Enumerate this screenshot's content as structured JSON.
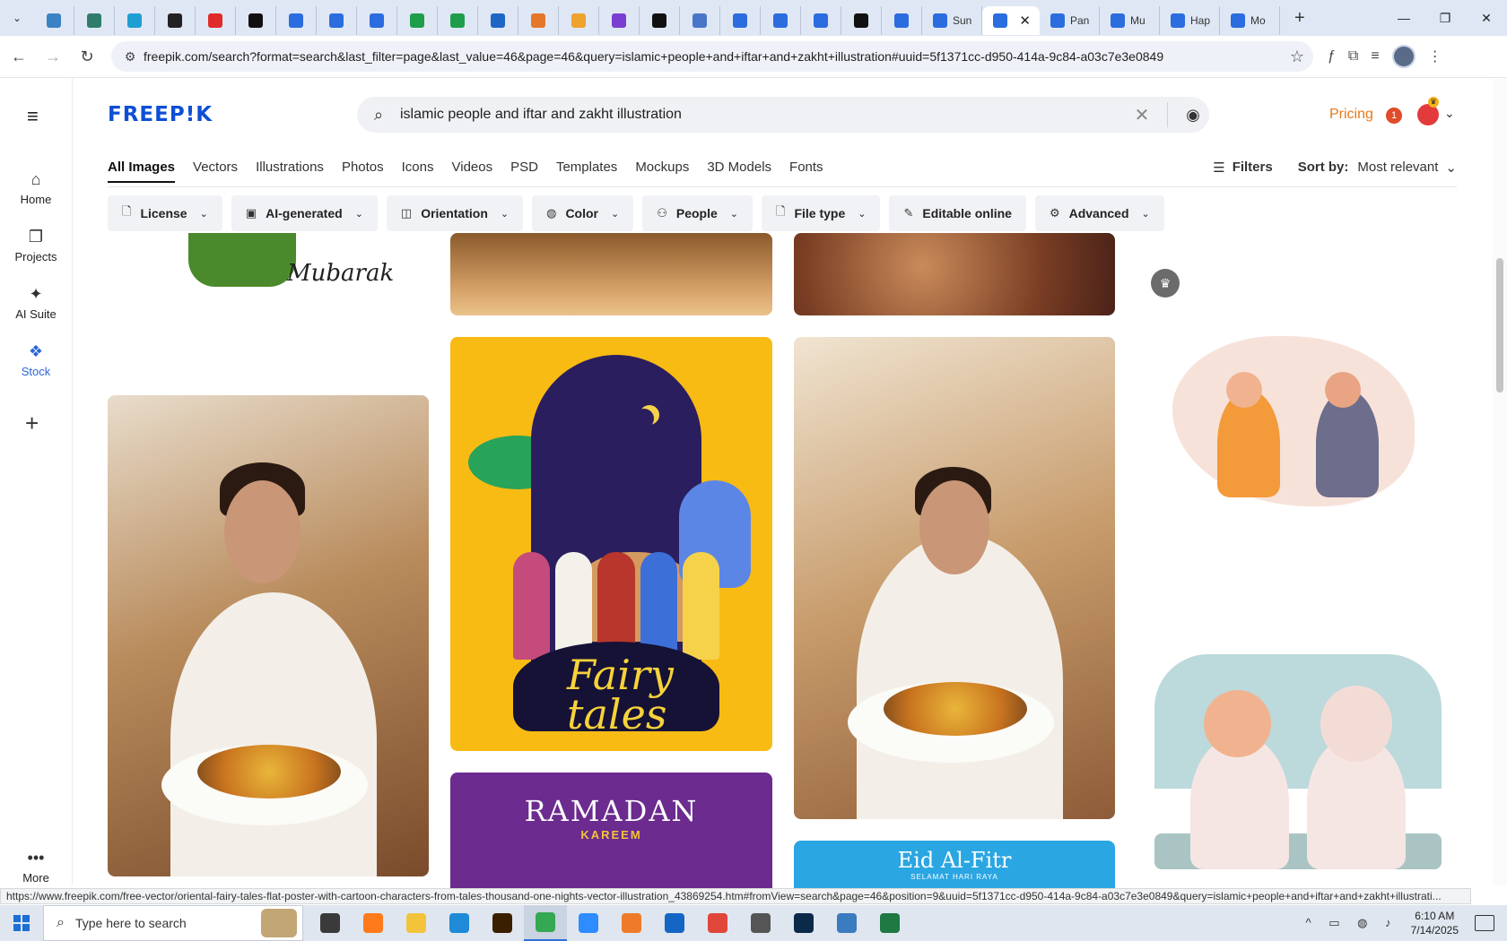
{
  "browser": {
    "tabs": [
      {
        "name": "tab-1",
        "fav": "#3b82c4",
        "title": ""
      },
      {
        "name": "tab-2",
        "fav": "#2e7d6b",
        "title": ""
      },
      {
        "name": "tab-3",
        "fav": "#1e9ed1",
        "title": ""
      },
      {
        "name": "tab-4",
        "fav": "#222222",
        "title": ""
      },
      {
        "name": "tab-5",
        "fav": "#e02b2b",
        "title": ""
      },
      {
        "name": "tab-6",
        "fav": "#111111",
        "title": ""
      },
      {
        "name": "tab-7",
        "fav": "#2b6cdf",
        "title": ""
      },
      {
        "name": "tab-8",
        "fav": "#2b6cdf",
        "title": ""
      },
      {
        "name": "tab-9",
        "fav": "#2b6cdf",
        "title": ""
      },
      {
        "name": "tab-10",
        "fav": "#1e9e4a",
        "title": ""
      },
      {
        "name": "tab-11",
        "fav": "#1e9e4a",
        "title": ""
      },
      {
        "name": "tab-12",
        "fav": "#1f66c4",
        "title": ""
      },
      {
        "name": "tab-13",
        "fav": "#e5772a",
        "title": ""
      },
      {
        "name": "tab-14",
        "fav": "#f0a22e",
        "title": ""
      },
      {
        "name": "tab-15",
        "fav": "#7a3fd1",
        "title": ""
      },
      {
        "name": "tab-16",
        "fav": "#111111",
        "title": ""
      },
      {
        "name": "tab-17",
        "fav": "#4a76c9",
        "title": ""
      },
      {
        "name": "tab-18",
        "fav": "#2b6cdf",
        "title": ""
      },
      {
        "name": "tab-19",
        "fav": "#2b6cdf",
        "title": ""
      },
      {
        "name": "tab-20",
        "fav": "#2b6cdf",
        "title": ""
      },
      {
        "name": "tab-21",
        "fav": "#111111",
        "title": ""
      },
      {
        "name": "tab-22",
        "fav": "#2b6cdf",
        "title": ""
      },
      {
        "name": "tab-23",
        "fav": "#2b6cdf",
        "title": "Sun"
      },
      {
        "name": "tab-active",
        "fav": "#2b6cdf",
        "title": "",
        "active": true
      },
      {
        "name": "tab-25",
        "fav": "#2b6cdf",
        "title": "Pan"
      },
      {
        "name": "tab-26",
        "fav": "#2b6cdf",
        "title": "Mu"
      },
      {
        "name": "tab-27",
        "fav": "#2b6cdf",
        "title": "Hap"
      },
      {
        "name": "tab-28",
        "fav": "#2b6cdf",
        "title": "Mo"
      }
    ],
    "new_tab": "+",
    "close_glyph": "✕",
    "minimize": "—",
    "restore": "❐",
    "close": "✕",
    "url": "freepik.com/search?format=search&last_filter=page&last_value=46&page=46&query=islamic+people+and+iftar+and+zakht+illustration#uuid=5f1371cc-d950-414a-9c84-a03c7e3e0849"
  },
  "header": {
    "logo": "FREEP!K",
    "search_value": "islamic people and iftar and zakht illustration",
    "pricing": "Pricing",
    "notif_count": "1",
    "accent": "#e6791b",
    "brand": "#0d4fd6"
  },
  "rail": {
    "items": [
      {
        "label": "Home",
        "icon": "home-icon",
        "glyph": "⌂"
      },
      {
        "label": "Projects",
        "icon": "projects-icon",
        "glyph": "❐"
      },
      {
        "label": "AI Suite",
        "icon": "sparkle-icon",
        "glyph": "✦"
      },
      {
        "label": "Stock",
        "icon": "stock-icon",
        "glyph": "❖",
        "selected": true
      }
    ],
    "more_label": "More",
    "more_glyph": "•••"
  },
  "categories": [
    "All Images",
    "Vectors",
    "Illustrations",
    "Photos",
    "Icons",
    "Videos",
    "PSD",
    "Templates",
    "Mockups",
    "3D Models",
    "Fonts"
  ],
  "filters_label": "Filters",
  "sort_label": "Sort by:",
  "sort_value": "Most relevant",
  "pills": [
    {
      "label": "License",
      "icon": "license-icon",
      "glyph": "🗋"
    },
    {
      "label": "AI-generated",
      "icon": "ai-icon",
      "glyph": "▣"
    },
    {
      "label": "Orientation",
      "icon": "orientation-icon",
      "glyph": "◫"
    },
    {
      "label": "Color",
      "icon": "palette-icon",
      "glyph": "◍"
    },
    {
      "label": "People",
      "icon": "people-icon",
      "glyph": "⚇"
    },
    {
      "label": "File type",
      "icon": "file-icon",
      "glyph": "🗋"
    },
    {
      "label": "Editable online",
      "icon": "pencil-icon",
      "glyph": "✎"
    },
    {
      "label": "Advanced",
      "icon": "gear-icon",
      "glyph": "⚙"
    }
  ],
  "cards": {
    "mubarak_text": "Mubarak",
    "fairy_tales_text": "Fairy tales",
    "ramadan_title": "RAMADAN",
    "ramadan_sub": "KAREEM",
    "eid_title": "Eid Al-Fitr",
    "eid_sub": "SELAMAT HARI RAYA"
  },
  "status_url": "https://www.freepik.com/free-vector/oriental-fairy-tales-flat-poster-with-cartoon-characters-from-tales-thousand-one-nights-vector-illustration_43869254.htm#fromView=search&page=46&position=9&uuid=5f1371cc-d950-414a-9c84-a03c7e3e0849&query=islamic+people+and+iftar+and+zakht+illustrati...",
  "taskbar": {
    "search_placeholder": "Type here to search",
    "apps": [
      {
        "name": "taskview-app",
        "color": "#3a3a3a"
      },
      {
        "name": "firefox-app",
        "color": "#ff7a1a"
      },
      {
        "name": "explorer-app",
        "color": "#f3c43b"
      },
      {
        "name": "vscode-app",
        "color": "#1f8ad8"
      },
      {
        "name": "illustrator-app",
        "color": "#3a1f00"
      },
      {
        "name": "chrome-app",
        "color": "#34a853",
        "active": true
      },
      {
        "name": "zoom-app",
        "color": "#2d8cff"
      },
      {
        "name": "app-7",
        "color": "#ef7b2a"
      },
      {
        "name": "outlook-app",
        "color": "#1466c4"
      },
      {
        "name": "creative-cloud-app",
        "color": "#e0463a"
      },
      {
        "name": "app-10",
        "color": "#555555"
      },
      {
        "name": "photoshop-app",
        "color": "#0b2a4a"
      },
      {
        "name": "app-12",
        "color": "#3b7bbf"
      },
      {
        "name": "excel-app",
        "color": "#1e7a42"
      }
    ],
    "time": "6:10 AM",
    "date": "7/14/2025"
  }
}
